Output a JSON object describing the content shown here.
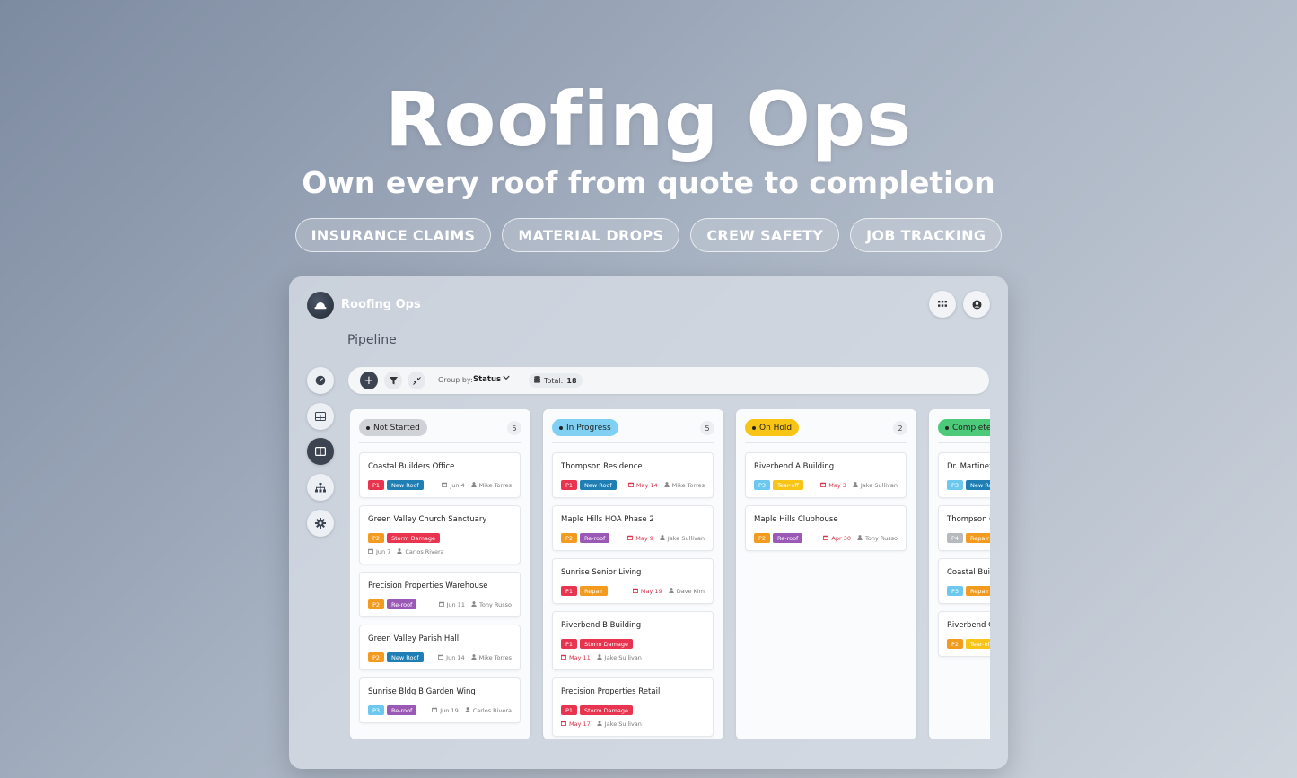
{
  "hero": {
    "title": "Roofing Ops",
    "subtitle": "Own every roof from quote to completion",
    "tags": [
      "INSURANCE CLAIMS",
      "MATERIAL DROPS",
      "CREW SAFETY",
      "JOB TRACKING"
    ]
  },
  "app": {
    "name": "Roofing Ops",
    "page_title": "Pipeline",
    "toolbar": {
      "group_by_label": "Group by:",
      "group_by_value": "Status",
      "total_label": "Total:",
      "total_value": "18"
    },
    "sidebar": [
      "dashboard-icon",
      "table-icon",
      "kanban-icon",
      "hierarchy-icon",
      "gear-icon"
    ],
    "header_buttons": [
      "grid-icon",
      "user-icon"
    ]
  },
  "colors": {
    "not_started": "#cfd3d8",
    "in_progress": "#7fd0f3",
    "on_hold": "#f8c516",
    "completed": "#4cca7a",
    "P1": "#e8344e",
    "P2": "#f39b1e",
    "P3": "#6cc8ee",
    "P4": "#b6b9bd",
    "New Roof": "#1f7fb5",
    "Storm Damage": "#e8344e",
    "Re-roof": "#9b59b6",
    "Repair": "#f39b1e",
    "Tear-off": "#f8c516"
  },
  "columns": [
    {
      "label": "Not Started",
      "count": "5",
      "cards": [
        {
          "title": "Coastal Builders Office",
          "priority": "P1",
          "type": "New Roof",
          "date": "Jun 4",
          "assignee": "Mike Torres",
          "overdue": false,
          "wrap": false
        },
        {
          "title": "Green Valley Church Sanctuary",
          "priority": "P2",
          "type": "Storm Damage",
          "date": "Jun 7",
          "assignee": "Carlos Rivera",
          "overdue": false,
          "wrap": true
        },
        {
          "title": "Precision Properties Warehouse",
          "priority": "P2",
          "type": "Re-roof",
          "date": "Jun 11",
          "assignee": "Tony Russo",
          "overdue": false,
          "wrap": false
        },
        {
          "title": "Green Valley Parish Hall",
          "priority": "P2",
          "type": "New Roof",
          "date": "Jun 14",
          "assignee": "Mike Torres",
          "overdue": false,
          "wrap": false
        },
        {
          "title": "Sunrise Bldg B Garden Wing",
          "priority": "P3",
          "type": "Re-roof",
          "date": "Jun 19",
          "assignee": "Carlos Rivera",
          "overdue": false,
          "wrap": false
        }
      ]
    },
    {
      "label": "In Progress",
      "count": "5",
      "cards": [
        {
          "title": "Thompson Residence",
          "priority": "P1",
          "type": "New Roof",
          "date": "May 14",
          "assignee": "Mike Torres",
          "overdue": true,
          "wrap": false
        },
        {
          "title": "Maple Hills HOA Phase 2",
          "priority": "P2",
          "type": "Re-roof",
          "date": "May 9",
          "assignee": "Jake Sullivan",
          "overdue": true,
          "wrap": false
        },
        {
          "title": "Sunrise Senior Living",
          "priority": "P1",
          "type": "Repair",
          "date": "May 19",
          "assignee": "Dave Kim",
          "overdue": true,
          "wrap": false
        },
        {
          "title": "Riverbend B Building",
          "priority": "P1",
          "type": "Storm Damage",
          "date": "May 11",
          "assignee": "Jake Sullivan",
          "overdue": true,
          "wrap": true
        },
        {
          "title": "Precision Properties Retail",
          "priority": "P1",
          "type": "Storm Damage",
          "date": "May 17",
          "assignee": "Jake Sullivan",
          "overdue": true,
          "wrap": true
        }
      ]
    },
    {
      "label": "On Hold",
      "count": "2",
      "cards": [
        {
          "title": "Riverbend A Building",
          "priority": "P3",
          "type": "Tear-off",
          "date": "May 3",
          "assignee": "Jake Sullivan",
          "overdue": true,
          "wrap": false
        },
        {
          "title": "Maple Hills Clubhouse",
          "priority": "P2",
          "type": "Re-roof",
          "date": "Apr 30",
          "assignee": "Tony Russo",
          "overdue": true,
          "wrap": false
        }
      ]
    },
    {
      "label": "Completed",
      "count": "",
      "cards": [
        {
          "title": "Dr. Martinez",
          "priority": "P3",
          "type": "New Roof",
          "date": "",
          "assignee": "",
          "overdue": false,
          "wrap": false
        },
        {
          "title": "Thompson C",
          "priority": "P4",
          "type": "Repair",
          "date": "",
          "assignee": "",
          "overdue": false,
          "wrap": false
        },
        {
          "title": "Coastal Buil",
          "priority": "P3",
          "type": "Repair",
          "date": "",
          "assignee": "",
          "overdue": false,
          "wrap": false
        },
        {
          "title": "Riverbend C",
          "priority": "P2",
          "type": "Tear-off",
          "date": "",
          "assignee": "",
          "overdue": false,
          "wrap": false
        }
      ]
    }
  ]
}
